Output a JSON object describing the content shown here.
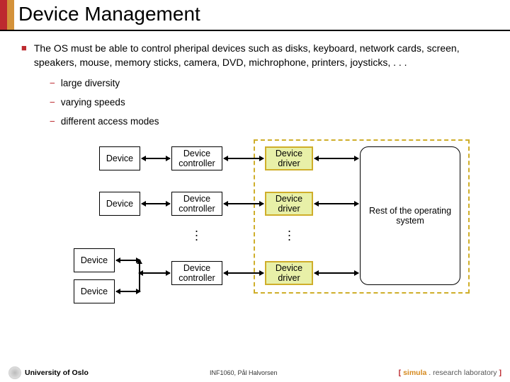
{
  "title": "Device Management",
  "bullet": "The OS must be able to control pheripal devices such as disks, keyboard, network cards, screen, speakers, mouse, memory sticks, camera, DVD, michrophone, printers, joysticks, . . .",
  "subs": {
    "a": "large diversity",
    "b": "varying speeds",
    "c": "different access modes"
  },
  "labels": {
    "device": "Device",
    "controller": "Device controller",
    "driver": "Device driver",
    "os": "Rest of the operating system"
  },
  "footer": {
    "uo": "University of Oslo",
    "center": "INF1060, Pål Halvorsen",
    "br_open": "[ ",
    "sim": "simula",
    "rl": " . research laboratory",
    "br_close": " ]"
  }
}
